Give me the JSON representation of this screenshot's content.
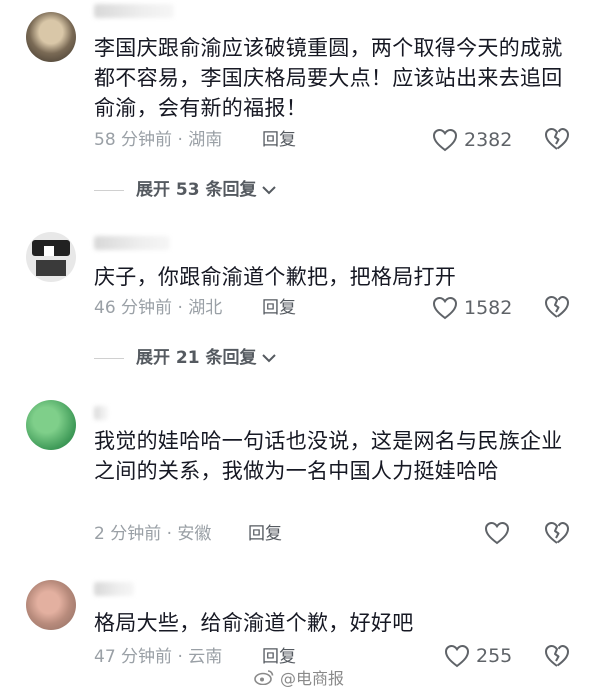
{
  "comments": [
    {
      "text": "李国庆跟俞渝应该破镜重圆，两个取得今天的成就都不容易，李国庆格局要大点！应该站出来去追回俞渝，会有新的福报！",
      "time_location": "58 分钟前 · 湖南",
      "reply_label": "回复",
      "likes": "2382",
      "expand_label": "展开 53 条回复"
    },
    {
      "text": "庆子，你跟俞渝道个歉把，把格局打开",
      "time_location": "46 分钟前 · 湖北",
      "reply_label": "回复",
      "likes": "1582",
      "expand_label": "展开 21 条回复"
    },
    {
      "text": "我觉的娃哈哈一句话也没说，这是网名与民族企业之间的关系，我做为一名中国人力挺娃哈哈",
      "time_location": "2 分钟前 · 安徽",
      "reply_label": "回复",
      "likes": ""
    },
    {
      "text": "格局大些，给俞渝道个歉，好好吧",
      "time_location": "47 分钟前 · 云南",
      "reply_label": "回复",
      "likes": "255"
    }
  ],
  "watermark": {
    "text": "@电商报",
    "icon": "weibo-icon"
  },
  "colors": {
    "text": "#161823",
    "meta": "#9aa0a6",
    "background": "#ffffff"
  }
}
